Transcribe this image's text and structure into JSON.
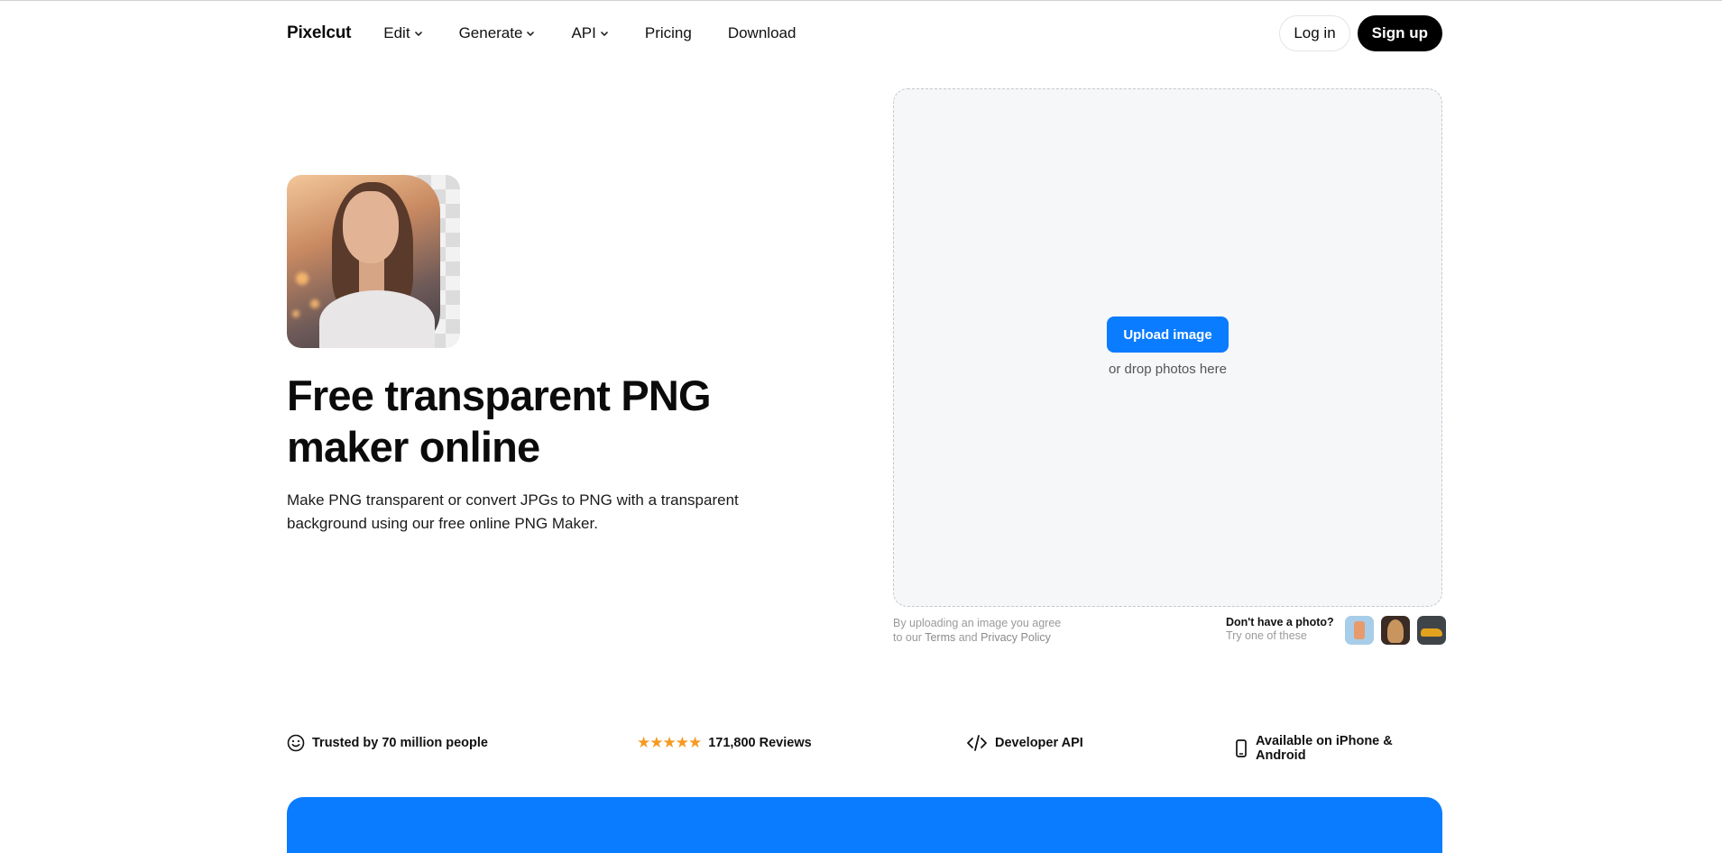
{
  "nav": {
    "logo": "Pixelcut",
    "links": [
      {
        "label": "Edit",
        "dropdown": true
      },
      {
        "label": "Generate",
        "dropdown": true
      },
      {
        "label": "API",
        "dropdown": true
      },
      {
        "label": "Pricing",
        "dropdown": false
      },
      {
        "label": "Download",
        "dropdown": false
      }
    ],
    "login_label": "Log in",
    "signup_label": "Sign up"
  },
  "hero": {
    "title": "Free transparent PNG maker online",
    "subtitle": "Make PNG transparent or convert JPGs to PNG with a transparent background using our free online PNG Maker."
  },
  "upload": {
    "button_label": "Upload image",
    "drop_text": "or drop photos here",
    "terms_line1": "By uploading an image you agree",
    "terms_prefix": "to our",
    "terms_link": "Terms",
    "terms_and": "and",
    "privacy_link": "Privacy Policy",
    "sample_question": "Don't have a photo?",
    "sample_try": "Try one of these"
  },
  "trust": {
    "users": "Trusted by 70 million people",
    "stars": "★★★★★",
    "reviews": "171,800 Reviews",
    "api": "Developer API",
    "mobile": "Available on iPhone & Android"
  },
  "colors": {
    "accent": "#0a7cff",
    "star": "#f59a23",
    "upload_bg": "#f6f7f9"
  }
}
